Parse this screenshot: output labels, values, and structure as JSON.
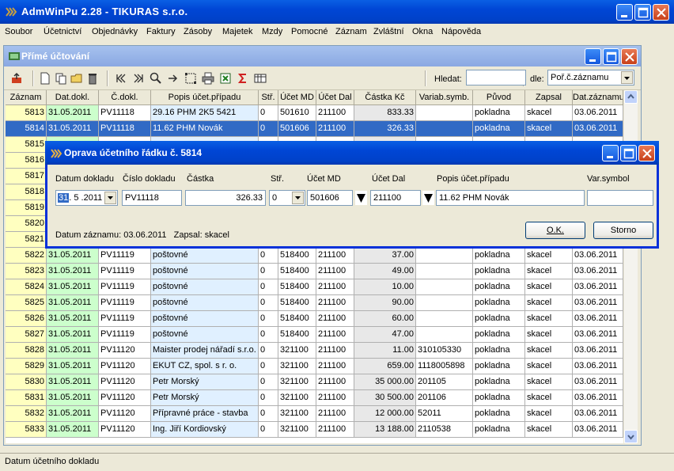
{
  "app": {
    "title": "AdmWinPu 2.28 - TIKURAS  s.r.o."
  },
  "menu": [
    "Soubor",
    "Účetnictví",
    "Objednávky",
    "Faktury",
    "Zásoby",
    "Majetek",
    "Mzdy",
    "Pomocné",
    "Záznam",
    "Zvláštní",
    "Okna",
    "Nápověda"
  ],
  "child": {
    "title": "Přímé účtování"
  },
  "search": {
    "label": "Hledat:",
    "value": "",
    "by_label": "dle:",
    "by_value": "Poř.č.záznamu"
  },
  "grid": {
    "headers": [
      "Záznam",
      "Dat.dokl.",
      "Č.dokl.",
      "Popis účet.případu",
      "Stř.",
      "Účet MD",
      "Účet Dal",
      "Částka Kč",
      "Variab.symb.",
      "Původ",
      "Zapsal",
      "Dat.záznamu"
    ],
    "rows": [
      [
        "5813",
        "31.05.2011",
        "PV11118",
        "29.16 PHM 2K5 5421",
        "0",
        "501610",
        "211100",
        "833.33",
        "",
        "pokladna",
        "skacel",
        "03.06.2011"
      ],
      [
        "5814",
        "31.05.2011",
        "PV11118",
        "11.62 PHM Novák",
        "0",
        "501606",
        "211100",
        "326.33",
        "",
        "pokladna",
        "skacel",
        "03.06.2011"
      ],
      [
        "5815",
        "",
        "",
        "",
        "",
        "",
        "",
        "",
        "",
        "",
        "",
        ""
      ],
      [
        "5816",
        "",
        "",
        "",
        "",
        "",
        "",
        "",
        "",
        "",
        "",
        ""
      ],
      [
        "5817",
        "",
        "",
        "",
        "",
        "",
        "",
        "",
        "",
        "",
        "",
        ""
      ],
      [
        "5818",
        "",
        "",
        "",
        "",
        "",
        "",
        "",
        "",
        "",
        "",
        ""
      ],
      [
        "5819",
        "",
        "",
        "",
        "",
        "",
        "",
        "",
        "",
        "",
        "",
        ""
      ],
      [
        "5820",
        "",
        "",
        "",
        "",
        "",
        "",
        "",
        "",
        "",
        "",
        ""
      ],
      [
        "5821",
        "",
        "",
        "",
        "",
        "",
        "",
        "",
        "",
        "",
        "",
        ""
      ],
      [
        "5822",
        "31.05.2011",
        "PV11119",
        "poštovné",
        "0",
        "518400",
        "211100",
        "37.00",
        "",
        "pokladna",
        "skacel",
        "03.06.2011"
      ],
      [
        "5823",
        "31.05.2011",
        "PV11119",
        "poštovné",
        "0",
        "518400",
        "211100",
        "49.00",
        "",
        "pokladna",
        "skacel",
        "03.06.2011"
      ],
      [
        "5824",
        "31.05.2011",
        "PV11119",
        "poštovné",
        "0",
        "518400",
        "211100",
        "10.00",
        "",
        "pokladna",
        "skacel",
        "03.06.2011"
      ],
      [
        "5825",
        "31.05.2011",
        "PV11119",
        "poštovné",
        "0",
        "518400",
        "211100",
        "90.00",
        "",
        "pokladna",
        "skacel",
        "03.06.2011"
      ],
      [
        "5826",
        "31.05.2011",
        "PV11119",
        "poštovné",
        "0",
        "518400",
        "211100",
        "60.00",
        "",
        "pokladna",
        "skacel",
        "03.06.2011"
      ],
      [
        "5827",
        "31.05.2011",
        "PV11119",
        "poštovné",
        "0",
        "518400",
        "211100",
        "47.00",
        "",
        "pokladna",
        "skacel",
        "03.06.2011"
      ],
      [
        "5828",
        "31.05.2011",
        "PV11120",
        "Maister prodej nářadí s.r.o.",
        "0",
        "321100",
        "211100",
        "11.00",
        "310105330",
        "pokladna",
        "skacel",
        "03.06.2011"
      ],
      [
        "5829",
        "31.05.2011",
        "PV11120",
        "EKUT CZ, spol. s r. o.",
        "0",
        "321100",
        "211100",
        "659.00",
        "1118005898",
        "pokladna",
        "skacel",
        "03.06.2011"
      ],
      [
        "5830",
        "31.05.2011",
        "PV11120",
        "Petr Morský",
        "0",
        "321100",
        "211100",
        "35 000.00",
        "201105",
        "pokladna",
        "skacel",
        "03.06.2011"
      ],
      [
        "5831",
        "31.05.2011",
        "PV11120",
        "Petr Morský",
        "0",
        "321100",
        "211100",
        "30 500.00",
        "201106",
        "pokladna",
        "skacel",
        "03.06.2011"
      ],
      [
        "5832",
        "31.05.2011",
        "PV11120",
        "Přípravné práce - stavba",
        "0",
        "321100",
        "211100",
        "12 000.00",
        "52011",
        "pokladna",
        "skacel",
        "03.06.2011"
      ],
      [
        "5833",
        "31.05.2011",
        "PV11120",
        "Ing. Jiří Kordiovský",
        "0",
        "321100",
        "211100",
        "13 188.00",
        "2110538",
        "pokladna",
        "skacel",
        "03.06.2011"
      ]
    ],
    "selected_row": "5814"
  },
  "dialog": {
    "title": "Oprava účetního řádku č. 5814",
    "labels": {
      "datum": "Datum dokladu",
      "cislo": "Číslo dokladu",
      "castka": "Částka",
      "str": "Stř.",
      "md": "Účet MD",
      "dal": "Účet Dal",
      "popis": "Popis účet.případu",
      "var": "Var.symbol"
    },
    "values": {
      "datum_day": "31",
      "datum_rest": ". 5 .2011",
      "cislo": "PV11118",
      "castka": "326.33",
      "str": "0",
      "md": "501606",
      "dal": "211100",
      "popis": "11.62 PHM Novák",
      "var": ""
    },
    "info": "Datum záznamu: 03.06.2011   Zapsal: skacel",
    "ok": "O.K.",
    "cancel": "Storno"
  },
  "status": {
    "text": "Datum účetního dokladu"
  },
  "colors": {
    "title_blue": "#0046d5",
    "selected": "#316ac5",
    "zaznam_bg": "#ffffc0",
    "date_bg": "#ccffcc",
    "desc_bg": "#e0f0ff",
    "amount_bg": "#e8e8e8"
  }
}
